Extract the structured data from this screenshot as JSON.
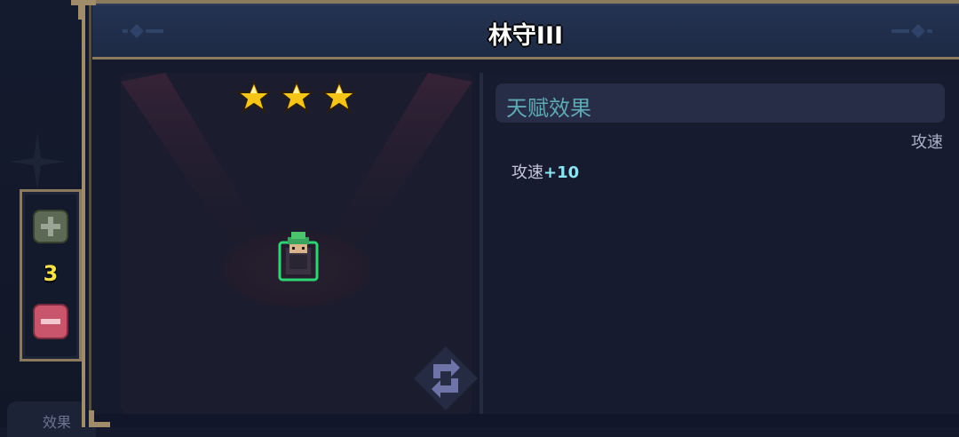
{
  "header": {
    "title": "林守III"
  },
  "stepper": {
    "level": "3"
  },
  "hero": {
    "stars": 3
  },
  "talent": {
    "title": "天赋效果",
    "tag": "攻速",
    "stat_label": "攻速",
    "stat_value": "+10"
  },
  "bottom_tab": {
    "label": "效果"
  },
  "colors": {
    "frame_gold": "#8c7a5e",
    "star": "#f5c518",
    "plus_button": "#5c6a55",
    "minus_button": "#c9556c",
    "level_text": "#f6e34a",
    "talent_title": "#5fa9b4",
    "stat_value": "#8ee5f2",
    "hero_outline": "#2ed573"
  },
  "icons": [
    "plus-icon",
    "minus-icon",
    "star-icon",
    "swap-icon",
    "sparkle-icon"
  ]
}
